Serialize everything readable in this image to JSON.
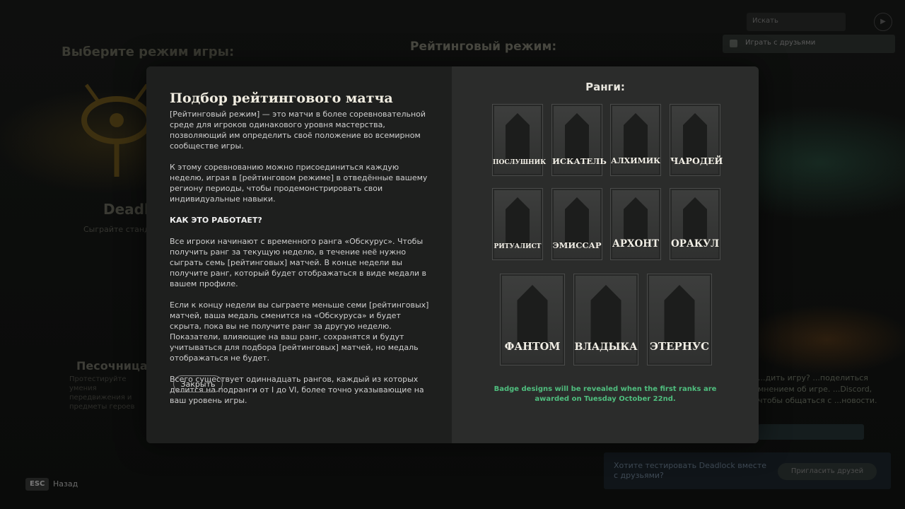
{
  "background": {
    "left_title": "Выберите режим игры:",
    "center_title": "Рейтинговый режим:",
    "search_placeholder": "Искать",
    "play_with_friends": "Играть с друзьями",
    "deadlock_title": "Deadlo",
    "deadlock_sub": "Сыграйте станд... против други...",
    "sandbox_title": "Песочница",
    "sandbox_sub": "Протестируйте умения передвижения и предметы героев",
    "right_text": "...дить игру? ...поделиться мнением об игре. ...Discord, чтобы общаться с ...новости.",
    "invite_text": "Хотите тестировать Deadlock вместе с друзьями?",
    "invite_button": "Пригласить друзей"
  },
  "footer": {
    "esc": "ESC",
    "back": "Назад"
  },
  "modal": {
    "title": "Подбор рейтингового матча",
    "paragraphs": [
      "[Рейтинговый режим] — это матчи в более соревновательной среде для игроков одинакового уровня мастерства, позволяющий им определить своё положение во всемирном сообществе игры.",
      "К этому соревнованию можно присоединиться каждую неделю, играя в [рейтинговом режиме] в отведённые вашему региону периоды, чтобы продемонстрировать свои индивидуальные навыки."
    ],
    "how_heading": "КАК ЭТО РАБОТАЕТ?",
    "how_paragraphs": [
      "Все игроки начинают с временного ранга «Обскурус». Чтобы получить ранг за текущую неделю, в течение неё нужно сыграть семь [рейтинговых] матчей. В конце недели вы получите ранг, который будет отображаться в виде медали в вашем профиле.",
      "Если к концу недели вы сыграете меньше семи [рейтинговых] матчей, ваша медаль сменится на «Обскуруса» и будет скрыта, пока вы не получите ранг за другую неделю. Показатели, влияющие на ваш ранг, сохранятся и будут учитываться для подбора [рейтинговых] матчей, но медаль отображаться не будет.",
      "Всего существует одиннадцать рангов, каждый из которых делится на подранги от I до VI, более точно указывающие на ваш уровень игры."
    ],
    "close_button": "Закрыть",
    "ranks_title": "Ранги:",
    "ranks": [
      "ПОСЛУШНИК",
      "ИСКАТЕЛЬ",
      "АЛХИМИК",
      "ЧАРОДЕЙ",
      "РИТУАЛИСТ",
      "ЭМИССАР",
      "АРХОНТ",
      "ОРАКУЛ",
      "ФАНТОМ",
      "ВЛАДЫКА",
      "ЭТЕРНУС"
    ],
    "badge_note": "Badge designs will be revealed when the first ranks are awarded on Tuesday October 22nd."
  },
  "colors": {
    "accent_green": "#4fbe7e",
    "modal_left": "#1e1f1e",
    "modal_right": "#2b2c2b"
  }
}
